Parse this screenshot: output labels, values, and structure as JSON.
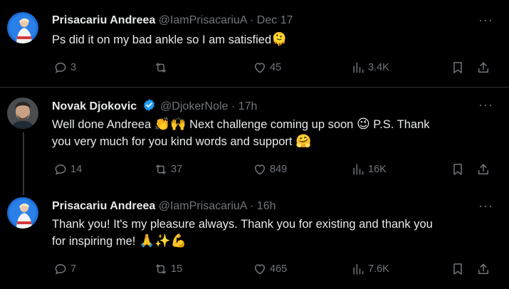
{
  "tweets": [
    {
      "name": "Prisacariu Andreea",
      "handle": "@IamPrisacariuA",
      "separator": "·",
      "time": "Dec 17",
      "text_lines": [
        "Ps did it on my bad ankle so I am satisfied"
      ],
      "text_emoji": "🫠",
      "stats": {
        "replies": "3",
        "reposts": "",
        "likes": "45",
        "views": "3.4K"
      },
      "avatar_icon": "avatar-tennis-player-icon"
    },
    {
      "name": "Novak Djokovic",
      "verified": true,
      "handle": "@DjokerNole",
      "separator": "·",
      "time": "17h",
      "text_line1_a": "Well done Andreea ",
      "text_line1_emoji1": "👏🙌",
      "text_line1_b": " Next challenge coming up soon ",
      "text_line1_emoji2": "😉",
      "text_line1_c": " P.S. Thank",
      "text_line2_a": "you very much for you kind words and support ",
      "text_line2_emoji": "🤗",
      "stats": {
        "replies": "14",
        "reposts": "37",
        "likes": "849",
        "views": "16K"
      },
      "avatar_icon": "avatar-portrait-icon"
    },
    {
      "name": "Prisacariu Andreea",
      "handle": "@IamPrisacariuA",
      "separator": "·",
      "time": "16h",
      "text_line1": "Thank you! It's my pleasure always. Thank you for existing and thank you",
      "text_line2_a": "for inspiring me! ",
      "text_line2_emoji": "🙏✨💪",
      "stats": {
        "replies": "7",
        "reposts": "15",
        "likes": "465",
        "views": "7.6K"
      },
      "avatar_icon": "avatar-tennis-player-icon"
    }
  ],
  "more_label": "···",
  "colors": {
    "background": "#000000",
    "text_primary": "#e7e9ea",
    "text_secondary": "#71767b",
    "divider": "#2f3336",
    "verified": "#1d9bf0"
  }
}
